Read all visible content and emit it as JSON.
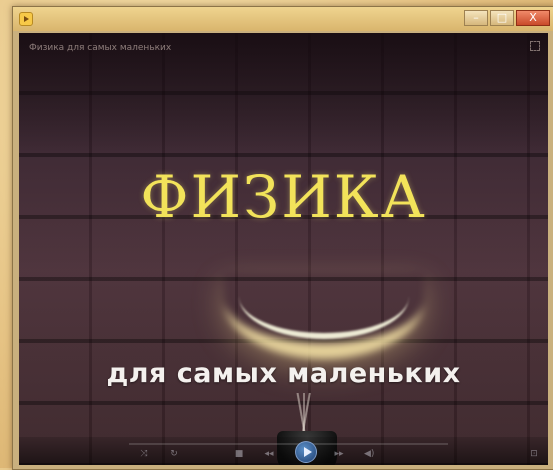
{
  "window": {
    "title_icon": "media-player-icon",
    "controls": {
      "minimize": "–",
      "maximize": "□",
      "close": "X"
    }
  },
  "video": {
    "title": "Физика для самых маленьких",
    "main_title": "ФИЗИКА",
    "subtitle": "для самых маленьких"
  },
  "player": {
    "icons": [
      "shuffle-icon",
      "repeat-icon",
      "stop-icon",
      "previous-icon",
      "play-icon",
      "next-icon",
      "volume-icon",
      "fullscreen-icon"
    ]
  },
  "colors": {
    "title_yellow": "#f2e35a",
    "subtitle_white": "#f4f1ee",
    "background_dark": "#3b2530"
  }
}
